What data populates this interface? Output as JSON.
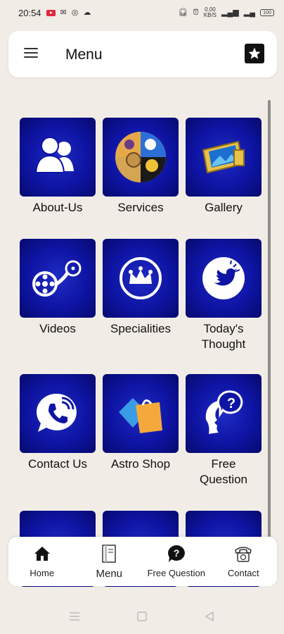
{
  "status_bar": {
    "time": "20:54",
    "speed_top": "0.00",
    "speed_bottom": "KB/S",
    "battery": "100"
  },
  "header": {
    "title": "Menu"
  },
  "tiles": [
    {
      "label": "About-Us",
      "icon": "users-icon"
    },
    {
      "label": "Services",
      "icon": "services-collage-icon"
    },
    {
      "label": "Gallery",
      "icon": "photo-gallery-icon"
    },
    {
      "label": "Videos",
      "icon": "film-reel-icon"
    },
    {
      "label": "Specialities",
      "icon": "crown-icon"
    },
    {
      "label": "Today's Thought",
      "label_line1": "Today's",
      "label_line2": "Thought",
      "icon": "twitter-bird-icon"
    },
    {
      "label": "Contact Us",
      "icon": "phone-chat-icon"
    },
    {
      "label": "Astro Shop",
      "icon": "shopping-bags-icon"
    },
    {
      "label": "Free Question",
      "label_line1": "Free",
      "label_line2": "Question",
      "icon": "head-question-icon"
    }
  ],
  "bottom_nav": [
    {
      "label": "Home",
      "icon": "home-icon"
    },
    {
      "label": "Menu",
      "icon": "menu-book-icon"
    },
    {
      "label": "Free Question",
      "icon": "question-bubble-icon"
    },
    {
      "label": "Contact",
      "icon": "telephone-icon"
    }
  ],
  "colors": {
    "tile_blue": "#0e14a3",
    "background": "#f1ede6",
    "card": "#ffffff"
  }
}
